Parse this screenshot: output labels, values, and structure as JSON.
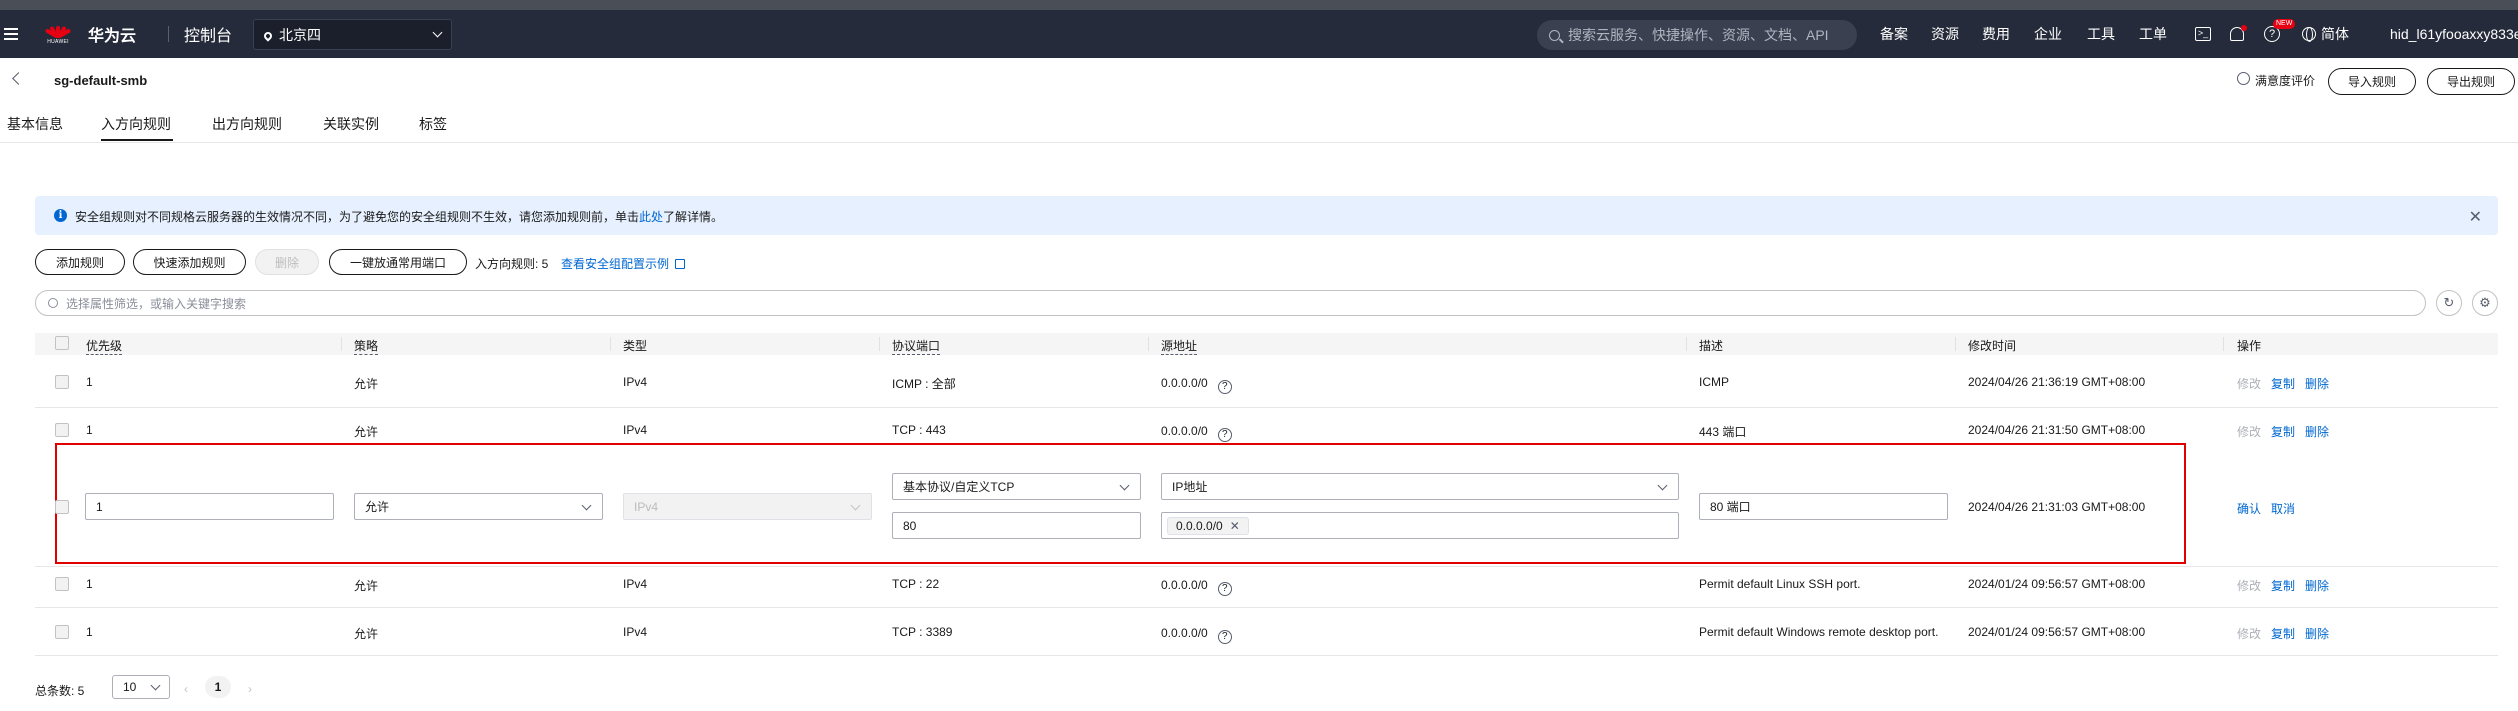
{
  "topbar": {
    "brand": "华为云",
    "logo_sub": "HUAWEI",
    "console": "控制台",
    "region": "北京四",
    "search_placeholder": "搜索云服务、快捷操作、资源、文档、API",
    "nav": [
      "备案",
      "资源",
      "费用",
      "企业",
      "工具",
      "工单"
    ],
    "new_badge": "NEW",
    "language": "简体",
    "user": "hid_l61yfooaxxy833e"
  },
  "header": {
    "title": "sg-default-smb",
    "rating": "满意度评价",
    "import_btn": "导入规则",
    "export_btn": "导出规则"
  },
  "tabs": [
    "基本信息",
    "入方向规则",
    "出方向规则",
    "关联实例",
    "标签"
  ],
  "info": {
    "text_before": "安全组规则对不同规格云服务器的生效情况不同，为了避免您的安全组规则不生效，请您添加规则前，单击",
    "link": "此处",
    "text_after": "了解详情。"
  },
  "toolbar": {
    "add": "添加规则",
    "quick_add": "快速添加规则",
    "delete": "删除",
    "open_common": "一键放通常用端口",
    "count": "入方向规则: 5",
    "config_link": "查看安全组配置示例"
  },
  "filter_placeholder": "选择属性筛选，或输入关键字搜索",
  "columns": [
    "优先级",
    "策略",
    "类型",
    "协议端口",
    "源地址",
    "描述",
    "修改时间",
    "操作"
  ],
  "rows": [
    {
      "priority": "1",
      "policy": "允许",
      "type": "IPv4",
      "port": "ICMP : 全部",
      "source": "0.0.0.0/0",
      "desc": "ICMP",
      "time": "2024/04/26 21:36:19 GMT+08:00"
    },
    {
      "priority": "1",
      "policy": "允许",
      "type": "IPv4",
      "port": "TCP : 443",
      "source": "0.0.0.0/0",
      "desc": "443 端口",
      "time": "2024/04/26 21:31:50 GMT+08:00"
    },
    {
      "priority": "1",
      "policy": "允许",
      "type": "IPv4",
      "port": "TCP : 22",
      "source": "0.0.0.0/0",
      "desc": "Permit default Linux SSH port.",
      "time": "2024/01/24 09:56:57 GMT+08:00"
    },
    {
      "priority": "1",
      "policy": "允许",
      "type": "IPv4",
      "port": "TCP : 3389",
      "source": "0.0.0.0/0",
      "desc": "Permit default Windows remote desktop port.",
      "time": "2024/01/24 09:56:57 GMT+08:00"
    }
  ],
  "ops": {
    "modify": "修改",
    "copy": "复制",
    "delete": "删除",
    "confirm": "确认",
    "cancel": "取消"
  },
  "edit_row": {
    "priority": "1",
    "policy": "允许",
    "type": "IPv4",
    "protocol": "基本协议/自定义TCP",
    "port": "80",
    "source_type": "IP地址",
    "source_chip": "0.0.0.0/0",
    "desc": "80 端口",
    "time": "2024/04/26 21:31:03 GMT+08:00"
  },
  "pagination": {
    "total": "总条数: 5",
    "page_size": "10",
    "current": "1"
  },
  "colors": {
    "topbar": "#252b3a",
    "link": "#0067d1",
    "highlight": "#e00000",
    "info_bg": "#e6f0fe"
  }
}
